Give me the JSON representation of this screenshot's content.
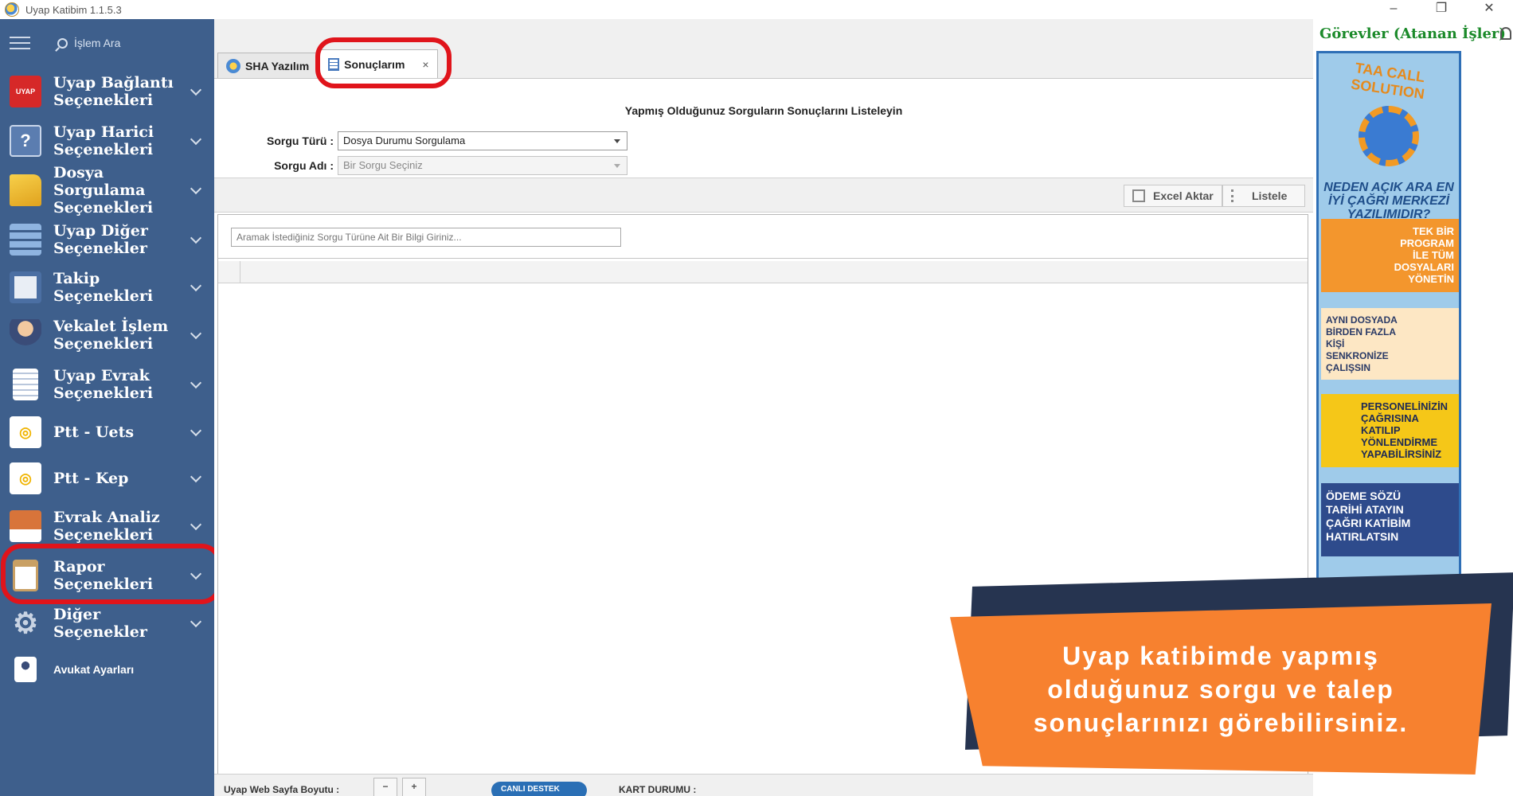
{
  "window": {
    "title": "Uyap Katibim 1.1.5.3"
  },
  "sidebar": {
    "search_label": "İşlem Ara",
    "items": [
      {
        "label": "Uyap Bağlantı Seçenekleri",
        "icon": "uyap-logo-icon",
        "icon_text": "UYAP"
      },
      {
        "label": "Uyap Harici Seçenekleri",
        "icon": "help-book-icon",
        "icon_text": "?"
      },
      {
        "label": "Dosya Sorgulama Seçenekleri",
        "icon": "folder-icon",
        "icon_text": ""
      },
      {
        "label": "Uyap Diğer Seçenekler",
        "icon": "grid-list-icon",
        "icon_text": ""
      },
      {
        "label": "Takip Seçenekleri",
        "icon": "frame-icon",
        "icon_text": ""
      },
      {
        "label": "Vekalet İşlem Seçenekleri",
        "icon": "lawyer-icon",
        "icon_text": ""
      },
      {
        "label": "Uyap Evrak Seçenekleri",
        "icon": "document-icon",
        "icon_text": ""
      },
      {
        "label": "Ptt - Uets",
        "icon": "ptt-icon",
        "icon_text": ""
      },
      {
        "label": "Ptt - Kep",
        "icon": "ptt-icon",
        "icon_text": ""
      },
      {
        "label": "Evrak Analiz Seçenekleri",
        "icon": "briefcase-icon",
        "icon_text": ""
      },
      {
        "label": "Rapor Seçenekleri",
        "icon": "clipboard-icon",
        "icon_text": ""
      },
      {
        "label": "Diğer Seçenekler",
        "icon": "gear-icon",
        "icon_text": ""
      },
      {
        "label": "Avukat Ayarları",
        "icon": "user-card-icon",
        "icon_text": ""
      }
    ]
  },
  "tabs": [
    {
      "label": "SHA Yazılım",
      "active": false
    },
    {
      "label": "Sonuçlarım",
      "active": true,
      "close": "×"
    }
  ],
  "main": {
    "heading": "Yapmış Olduğunuz Sorguların Sonuçlarını Listeleyin",
    "sorgu_turu_label": "Sorgu Türü :",
    "sorgu_turu_value": "Dosya Durumu Sorgulama",
    "sorgu_adi_label": "Sorgu Adı :",
    "sorgu_adi_placeholder": "Bir Sorgu Seçiniz",
    "excel_label": "Excel Aktar",
    "listele_label": "Listele",
    "search_placeholder": "Aramak İstediğiniz Sorgu Türüne Ait Bir Bilgi Giriniz..."
  },
  "statusbar": {
    "zoom_label": "Uyap Web Sayfa Boyutu :",
    "zoom_out": "−",
    "zoom_in": "+",
    "support_label": "CANLI DESTEK",
    "card_status_label": "KART DURUMU :"
  },
  "right_panel": {
    "title": "Görevler (Atanan İşler)",
    "ad": {
      "brand": "TAA CALL SOLUTION",
      "question": "NEDEN AÇIK ARA EN İYİ ÇAĞRI MERKEZİ YAZILIMIDIR?",
      "card1": "TEK BİR PROGRAM İLE TÜM DOSYALARI YÖNETİN",
      "card2": "AYNI DOSYADA BİRDEN FAZLA KİŞİ SENKRONİZE ÇALIŞSIN",
      "card3": "PERSONELİNİZİN ÇAĞRISINA KATILIP YÖNLENDİRME YAPABİLİRSİNİZ",
      "card4": "ÖDEME SÖZÜ TARİHİ ATAYIN ÇAĞRI KATİBİM HATIRLATSIN"
    }
  },
  "banner": {
    "text": "Uyap katibimde yapmış olduğunuz sorgu ve talep sonuçlarınızı görebilirsiniz."
  },
  "colors": {
    "sidebar": "#3e5f8c",
    "highlight": "#e0141b",
    "banner": "#f7812f",
    "task_title": "#1b8a2a"
  }
}
